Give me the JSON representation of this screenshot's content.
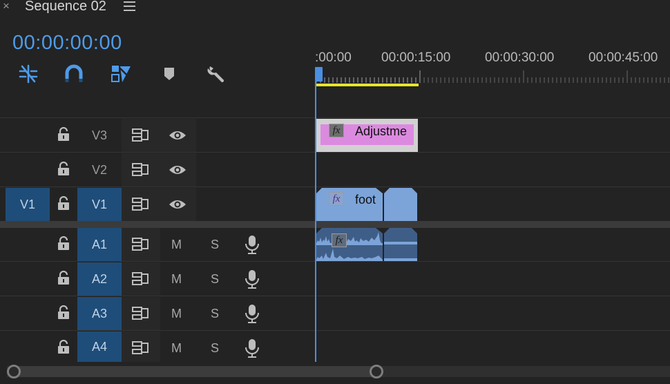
{
  "panel": {
    "close_glyph": "×",
    "title": "Sequence 02",
    "menu_icon": "hamburger-menu-icon"
  },
  "timecode": "00:00:00:00",
  "tools": [
    "snap-in-timeline-icon",
    "magnet-icon",
    "linked-selection-icon",
    "add-marker-icon",
    "wrench-settings-icon"
  ],
  "ruler": {
    "labels": [
      ":00:00",
      "00:00:15:00",
      "00:00:30:00",
      "00:00:45:00"
    ]
  },
  "tracks": {
    "video": [
      {
        "name": "V3",
        "source": ""
      },
      {
        "name": "V2",
        "source": ""
      },
      {
        "name": "V1",
        "source": "V1"
      }
    ],
    "audio": [
      {
        "name": "A1",
        "mute": "M",
        "solo": "S"
      },
      {
        "name": "A2",
        "mute": "M",
        "solo": "S"
      },
      {
        "name": "A3",
        "mute": "M",
        "solo": "S"
      },
      {
        "name": "A4",
        "mute": "M",
        "solo": "S"
      }
    ]
  },
  "clips": {
    "adjustment": {
      "label": "Adjustme",
      "fx": "fx",
      "color": "#dc8ae0"
    },
    "video": {
      "label": "foot",
      "fx": "fx",
      "color": "#7ca4d9"
    },
    "audio": {
      "fx": "fx",
      "color": "#3f5e87"
    }
  },
  "colors": {
    "accent": "#4f9be8",
    "target": "#1f4d79",
    "inout": "#e6e62a"
  }
}
